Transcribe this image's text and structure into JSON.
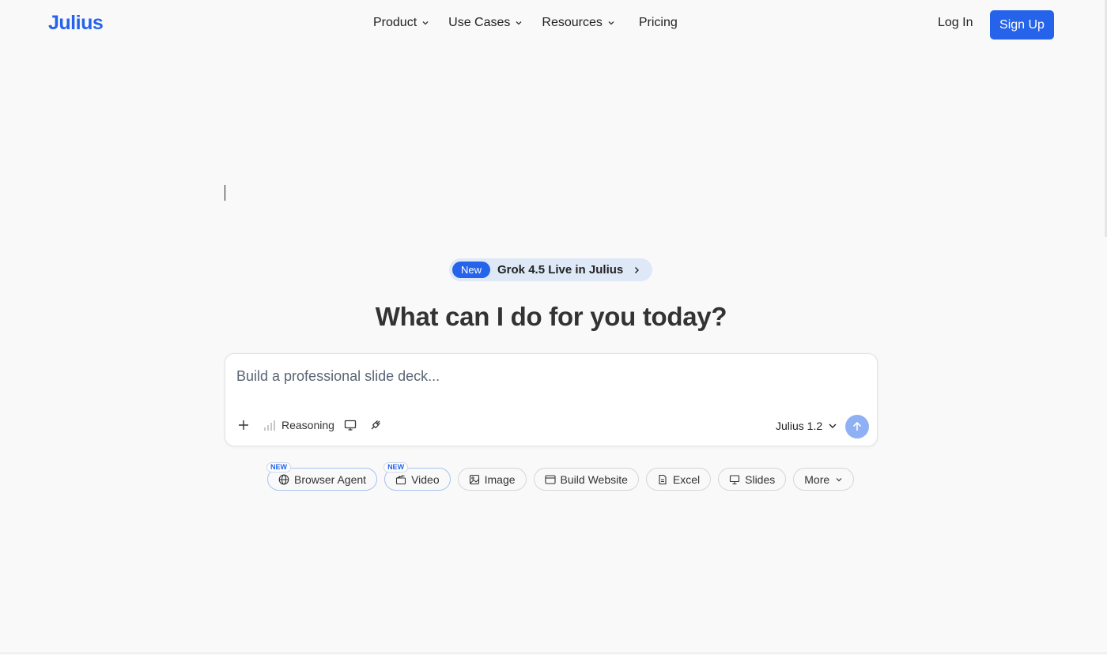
{
  "brand": {
    "logo_text": "Julius",
    "accent": "#2563eb"
  },
  "nav": {
    "items": [
      {
        "label": "Product",
        "has_dropdown": true
      },
      {
        "label": "Use Cases",
        "has_dropdown": true
      },
      {
        "label": "Resources",
        "has_dropdown": true
      },
      {
        "label": "Pricing",
        "has_dropdown": false
      }
    ],
    "login_label": "Log In",
    "signup_label": "Sign Up"
  },
  "announcement": {
    "badge": "New",
    "text": "Grok 4.5 Live in Julius",
    "icon": "chevron-right-icon"
  },
  "hero": {
    "headline": "What can I do for you today?"
  },
  "prompt": {
    "placeholder": "Build a professional slide deck...",
    "value": "",
    "tools": [
      {
        "name": "plus-icon"
      },
      {
        "name": "signal-bars-icon",
        "label": "Reasoning"
      },
      {
        "name": "monitor-icon"
      },
      {
        "name": "plug-icon"
      }
    ],
    "model_label": "Julius 1.2",
    "send_icon": "arrow-up-icon",
    "send_color": "#8fb0f3"
  },
  "chips": [
    {
      "label": "Browser Agent",
      "icon": "globe-icon",
      "new_tag": "NEW"
    },
    {
      "label": "Video",
      "icon": "clapperboard-icon",
      "new_tag": "NEW"
    },
    {
      "label": "Image",
      "icon": "image-icon"
    },
    {
      "label": "Build Website",
      "icon": "browser-window-icon"
    },
    {
      "label": "Excel",
      "icon": "document-icon"
    },
    {
      "label": "Slides",
      "icon": "presentation-icon"
    },
    {
      "label": "More",
      "icon": "chevron-down-icon"
    }
  ]
}
